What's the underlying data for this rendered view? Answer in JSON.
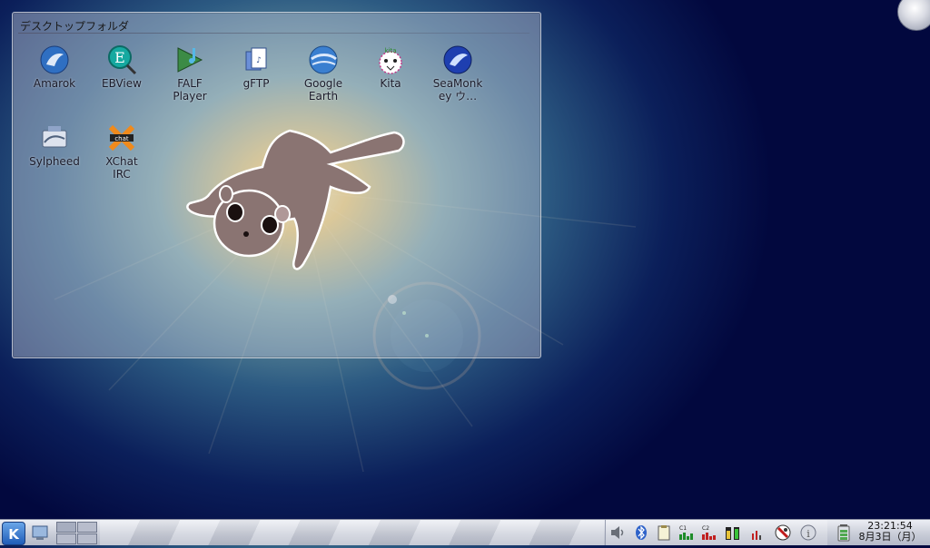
{
  "desktop_folder": {
    "title": "デスクトップフォルダ",
    "icons": [
      {
        "label": "Amarok",
        "icon": "amarok-icon"
      },
      {
        "label": "EBView",
        "icon": "ebview-icon"
      },
      {
        "label": "FALF\nPlayer",
        "icon": "falf-player-icon"
      },
      {
        "label": "gFTP",
        "icon": "gftp-icon"
      },
      {
        "label": "Google\nEarth",
        "icon": "google-earth-icon"
      },
      {
        "label": "Kita",
        "icon": "kita-icon"
      },
      {
        "label": "SeaMonk\ney ウ…",
        "icon": "seamonkey-icon"
      },
      {
        "label": "Sylpheed",
        "icon": "sylpheed-icon"
      },
      {
        "label": "XChat\nIRC",
        "icon": "xchat-icon"
      }
    ]
  },
  "taskbar": {
    "clock_time": "23:21:54",
    "clock_date": "8月3日（月）",
    "tray_icons": [
      "volume-icon",
      "bluetooth-icon",
      "clipboard-icon",
      "cpu1-monitor-icon",
      "cpu2-monitor-icon",
      "battery-monitor-icon",
      "network-icon",
      "kasumi-icon",
      "info-icon",
      "battery-icon"
    ]
  },
  "colors": {
    "bg_dark": "#02083e",
    "glow": "#f6e9b0",
    "taskbar": "#c9cdd8"
  }
}
